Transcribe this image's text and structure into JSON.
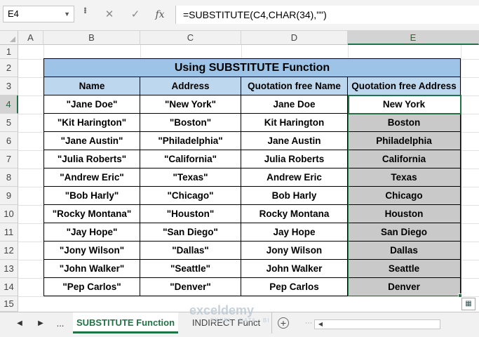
{
  "formula_bar": {
    "name_box": "E4",
    "cancel_icon": "✕",
    "enter_icon": "✓",
    "fx_label": "fx",
    "formula": "=SUBSTITUTE(C4,CHAR(34),\"\")"
  },
  "columns": [
    "A",
    "B",
    "C",
    "D",
    "E"
  ],
  "selected_column": "E",
  "rows": [
    "1",
    "2",
    "3",
    "4",
    "5",
    "6",
    "7",
    "8",
    "9",
    "10",
    "11",
    "12",
    "13",
    "14",
    "15"
  ],
  "selected_row": "4",
  "table": {
    "title": "Using SUBSTITUTE Function",
    "headers": [
      "Name",
      "Address",
      "Quotation free Name",
      "Quotation free Address"
    ],
    "rows": [
      [
        "\"Jane Doe\"",
        "\"New York\"",
        "Jane Doe",
        "New York"
      ],
      [
        "\"Kit Harington\"",
        "\"Boston\"",
        "Kit Harington",
        "Boston"
      ],
      [
        "\"Jane Austin\"",
        "\"Philadelphia\"",
        "Jane Austin",
        "Philadelphia"
      ],
      [
        "\"Julia Roberts\"",
        "\"California\"",
        "Julia Roberts",
        "California"
      ],
      [
        "\"Andrew Eric\"",
        "\"Texas\"",
        "Andrew Eric",
        "Texas"
      ],
      [
        "\"Bob Harly\"",
        "\"Chicago\"",
        "Bob Harly",
        "Chicago"
      ],
      [
        "\"Rocky Montana\"",
        "\"Houston\"",
        "Rocky Montana",
        "Houston"
      ],
      [
        "\"Jay Hope\"",
        "\"San Diego\"",
        "Jay Hope",
        "San Diego"
      ],
      [
        "\"Jony Wilson\"",
        "\"Dallas\"",
        "Jony Wilson",
        "Dallas"
      ],
      [
        "\"John Walker\"",
        "\"Seattle\"",
        "John Walker",
        "Seattle"
      ],
      [
        "\"Pep Carlos\"",
        "\"Denver\"",
        "Pep Carlos",
        "Denver"
      ]
    ]
  },
  "sheet_tabs": {
    "ellipsis": "...",
    "active": "SUBSTITUTE Function",
    "inactive": "INDIRECT Funct"
  },
  "watermark": {
    "brand": "exceldemy",
    "tagline": "EXCEL · DATA · BI"
  },
  "colors": {
    "title_fill": "#9dc3e6",
    "header_fill": "#bdd7ee",
    "shade_fill": "#c9c9c9",
    "excel_green": "#217346"
  }
}
